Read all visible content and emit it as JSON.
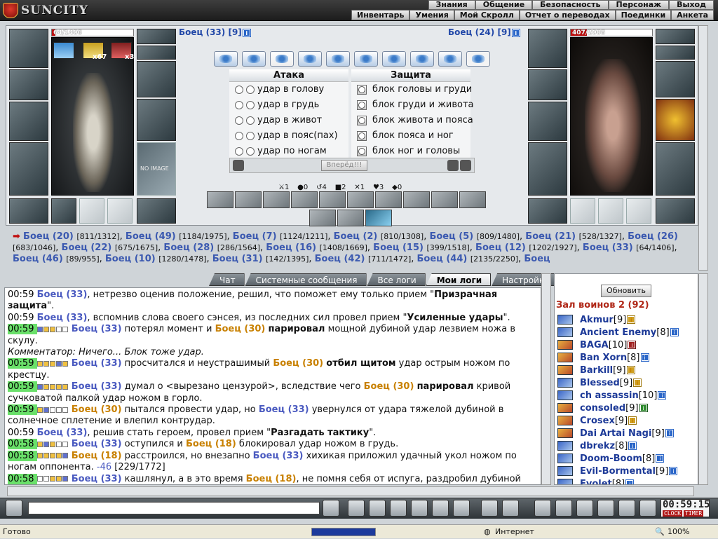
{
  "app": {
    "logo": "SUNCITY"
  },
  "menu": {
    "top": [
      "Знания",
      "Общение",
      "Безопасность",
      "Персонаж",
      "Выход"
    ],
    "sub": [
      "Инвентарь",
      "Умения",
      "Мой Скролл",
      "Отчет о переводах",
      "Поединки",
      "Анкета"
    ]
  },
  "fighter_left": {
    "name": "Боец (33)",
    "level": "[9]",
    "hp": "64/1406",
    "hp_fraction": 0.045,
    "buff1": "x67",
    "buff2": "x3",
    "no_image": "NO IMAGE"
  },
  "fighter_right": {
    "name": "Боец (24)",
    "level": "[9]",
    "hp": "407/2008",
    "hp_fraction": 0.2
  },
  "attack": {
    "title": "Атака",
    "items": [
      "удар в голову",
      "удар в грудь",
      "удар в живот",
      "удар в пояс(пах)",
      "удар по ногам"
    ]
  },
  "defense": {
    "title": "Защита",
    "items": [
      "блок головы и груди",
      "блок груди и живота",
      "блок живота и пояса",
      "блок пояса и ног",
      "блок ног и головы"
    ]
  },
  "forward_button": "Вперёд!!!",
  "stats": [
    "1",
    "0",
    "4",
    "2",
    "1",
    "3",
    "0"
  ],
  "fighters_line": [
    {
      "n": "Боец (20)",
      "hp": "[811/1312]"
    },
    {
      "n": "Боец (49)",
      "hp": "[1184/1975]"
    },
    {
      "n": "Боец (7)",
      "hp": "[1124/1211]"
    },
    {
      "n": "Боец (2)",
      "hp": "[810/1308]"
    },
    {
      "n": "Боец (5)",
      "hp": "[809/1480]"
    },
    {
      "n": "Боец (21)",
      "hp": "[528/1327]"
    },
    {
      "n": "Боец (26)",
      "hp": "[683/1046]"
    },
    {
      "n": "Боец (22)",
      "hp": "[675/1675]"
    },
    {
      "n": "Боец (28)",
      "hp": "[286/1564]"
    },
    {
      "n": "Боец (16)",
      "hp": "[1408/1669]"
    },
    {
      "n": "Боец (15)",
      "hp": "[399/1518]"
    },
    {
      "n": "Боец (12)",
      "hp": "[1202/1927]"
    },
    {
      "n": "Боец (33)",
      "hp": "[64/1406]"
    },
    {
      "n": "Боец (46)",
      "hp": "[89/955]"
    },
    {
      "n": "Боец (10)",
      "hp": "[1280/1478]"
    },
    {
      "n": "Боец (31)",
      "hp": "[142/1395]"
    },
    {
      "n": "Боец (42)",
      "hp": "[711/1472]"
    },
    {
      "n": "Боец (44)",
      "hp": "[2135/2250]"
    },
    {
      "n": "Боец",
      "hp": ""
    }
  ],
  "tabs": [
    "Чат",
    "Системные сообщения",
    "Все логи",
    "Мои логи",
    "Настройки"
  ],
  "log": [
    {
      "time": "00:59",
      "green": false,
      "parts": [
        [
          "b",
          "Боец (33)"
        ],
        [
          "t",
          ", нетрезво оценив положение, решил, что поможет ему только прием \""
        ],
        [
          "k",
          "Призрачная защита"
        ],
        [
          "t",
          "\"."
        ]
      ]
    },
    {
      "time": "00:59",
      "green": false,
      "parts": [
        [
          "b",
          "Боец (33)"
        ],
        [
          "t",
          ", вспомнив слова своего сэнсея, из последних сил провел прием \""
        ],
        [
          "k",
          "Усиленные удары"
        ],
        [
          "t",
          "\"."
        ]
      ]
    },
    {
      "time": "00:59",
      "green": true,
      "sq": "21100",
      "parts": [
        [
          "b",
          "Боец (33)"
        ],
        [
          "t",
          " потерял момент и "
        ],
        [
          "o",
          "Боец (30)"
        ],
        [
          "t",
          " "
        ],
        [
          "k",
          "парировал"
        ],
        [
          "t",
          " мощной дубиной удар лезвием ножа в скулу."
        ]
      ]
    },
    {
      "time": "",
      "green": false,
      "parts": [
        [
          "i",
          "Комментатор: Ничего... Блок тоже удар."
        ]
      ]
    },
    {
      "time": "00:59",
      "green": true,
      "sq": "11121",
      "parts": [
        [
          "b",
          "Боец (33)"
        ],
        [
          "t",
          " просчитался и неустрашимый "
        ],
        [
          "o",
          "Боец (30)"
        ],
        [
          "t",
          " "
        ],
        [
          "k",
          "отбил щитом"
        ],
        [
          "t",
          " удар острым ножом по крестцу."
        ]
      ]
    },
    {
      "time": "00:59",
      "green": true,
      "sq": "21111",
      "parts": [
        [
          "b",
          "Боец (33)"
        ],
        [
          "t",
          " думал о <вырезано цензурой>, вследствие чего "
        ],
        [
          "o",
          "Боец (30)"
        ],
        [
          "t",
          " "
        ],
        [
          "k",
          "парировал"
        ],
        [
          "t",
          " кривой сучковатой палкой удар ножом в горло."
        ]
      ]
    },
    {
      "time": "00:59",
      "green": true,
      "sq": "12000",
      "parts": [
        [
          "o",
          "Боец (30)"
        ],
        [
          "t",
          " пытался провести удар, но "
        ],
        [
          "b",
          "Боец (33)"
        ],
        [
          "t",
          " увернулся от удара тяжелой дубиной в солнечное сплетение и влепил контрудар."
        ]
      ]
    },
    {
      "time": "00:59",
      "green": false,
      "parts": [
        [
          "b",
          "Боец (33)"
        ],
        [
          "t",
          ", решив стать героем, провел прием \""
        ],
        [
          "k",
          "Разгадать тактику"
        ],
        [
          "t",
          "\"."
        ]
      ]
    },
    {
      "time": "00:58",
      "green": true,
      "sq": "12100",
      "parts": [
        [
          "b",
          "Боец (33)"
        ],
        [
          "t",
          " оступился и "
        ],
        [
          "o",
          "Боец (18)"
        ],
        [
          "t",
          " блокировал удар ножом в грудь."
        ]
      ]
    },
    {
      "time": "00:58",
      "green": true,
      "sq": "11112",
      "parts": [
        [
          "o",
          "Боец (18)"
        ],
        [
          "t",
          " расстроился, но внезапно "
        ],
        [
          "b",
          "Боец (33)"
        ],
        [
          "t",
          " хихикая приложил удачный укол ножом по ногам оппонента. "
        ],
        [
          "l",
          "-46"
        ],
        [
          "t",
          " [229/1772]"
        ]
      ]
    },
    {
      "time": "00:58",
      "green": true,
      "sq": "00112",
      "parts": [
        [
          "b",
          "Боец (33)"
        ],
        [
          "t",
          " кашлянул, а в это время "
        ],
        [
          "o",
          "Боец (18)"
        ],
        [
          "t",
          ", не помня себя от испуга, раздробил дубиной"
        ]
      ]
    }
  ],
  "right_panel": {
    "refresh": "Обновить",
    "room": "Зал воинов 2 (92)",
    "players": [
      {
        "name": "Akmur",
        "lvl": "[9]",
        "icon": "blue",
        "badge": "o"
      },
      {
        "name": "Ancient Enemy",
        "lvl": "[8]",
        "icon": "blue",
        "badge": "b"
      },
      {
        "name": "BAGA",
        "lvl": "[10]",
        "icon": "warrior",
        "badge": "r"
      },
      {
        "name": "Ban Xorn",
        "lvl": "[8]",
        "icon": "warrior",
        "badge": "b"
      },
      {
        "name": "Barkill",
        "lvl": "[9]",
        "icon": "warrior",
        "badge": "o"
      },
      {
        "name": "Blessed",
        "lvl": "[9]",
        "icon": "blue",
        "badge": "o"
      },
      {
        "name": "ch assassin",
        "lvl": "[10]",
        "icon": "blue",
        "badge": "b"
      },
      {
        "name": "consoled",
        "lvl": "[9]",
        "icon": "warrior",
        "badge": "g"
      },
      {
        "name": "Crosex",
        "lvl": "[9]",
        "icon": "warrior",
        "badge": "o"
      },
      {
        "name": "Dai Artai Nagi",
        "lvl": "[9]",
        "icon": "warrior",
        "badge": "b"
      },
      {
        "name": "dbrekz",
        "lvl": "[8]",
        "icon": "blue",
        "badge": "b"
      },
      {
        "name": "Doom-Boom",
        "lvl": "[8]",
        "icon": "blue",
        "badge": "b"
      },
      {
        "name": "Evil-Bormental",
        "lvl": "[9]",
        "icon": "blue",
        "badge": "b"
      },
      {
        "name": "Evolet",
        "lvl": "[8]",
        "icon": "blue",
        "badge": "b"
      }
    ]
  },
  "clock": {
    "time": "00:59",
    "sec": "15",
    "l1": "CLOCK",
    "l2": "TIMER"
  },
  "statusbar": {
    "left": "Готово",
    "zone": "Интернет",
    "zoom": "100%"
  },
  "colors": {
    "accent_blue": "#4a5ac0",
    "accent_orange": "#c88000",
    "hp_red": "#c41010",
    "room_red": "#b02818"
  }
}
